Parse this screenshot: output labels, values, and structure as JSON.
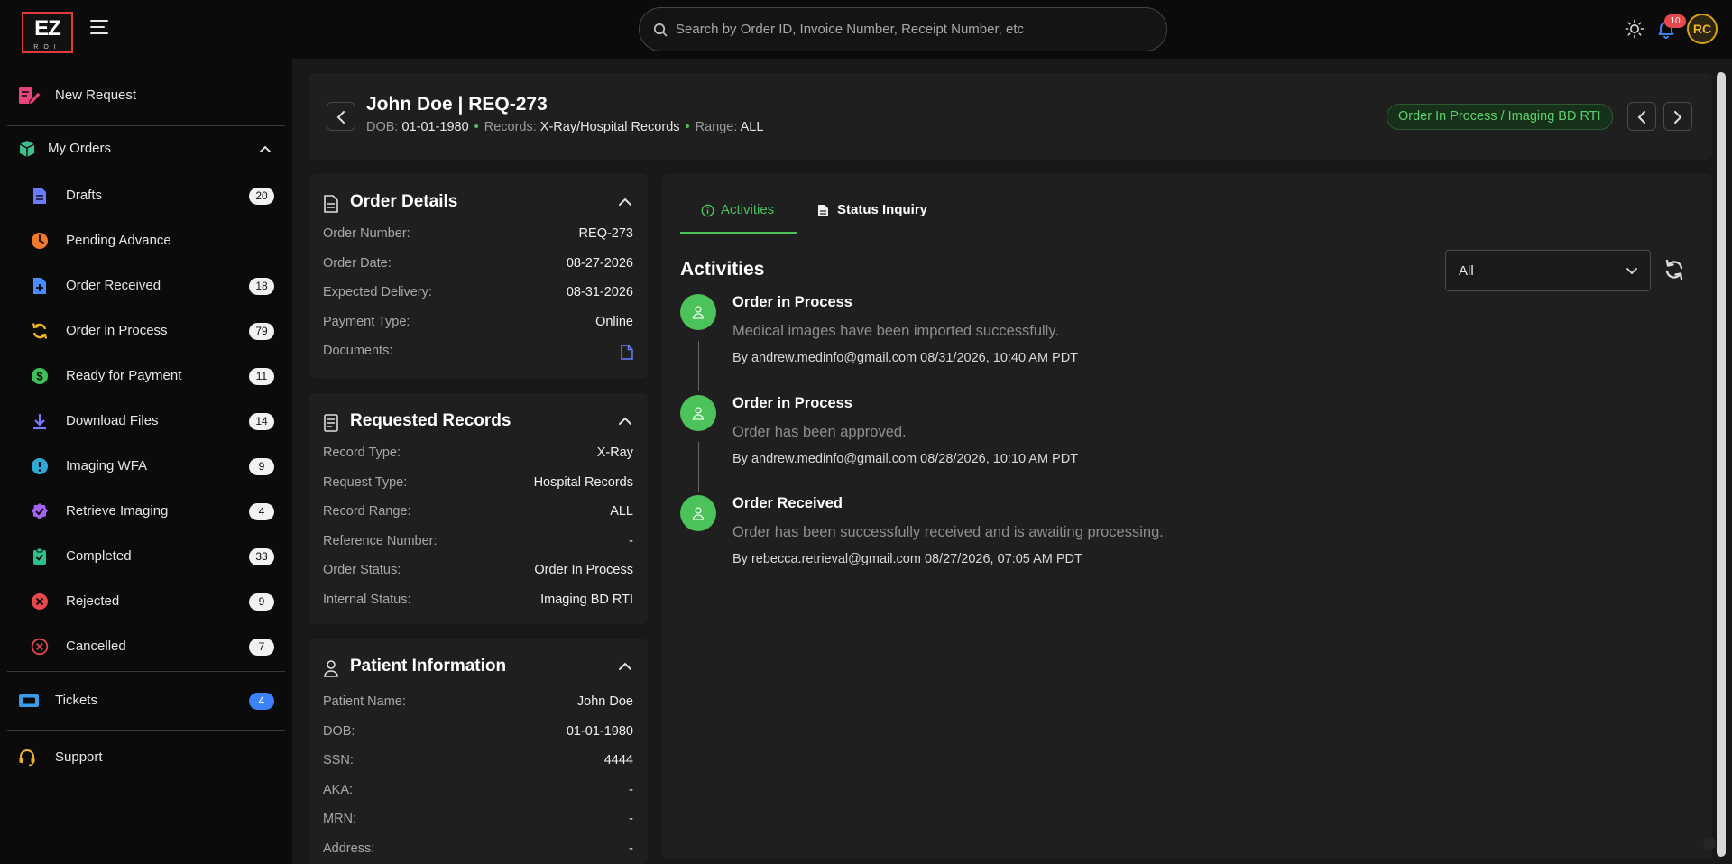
{
  "brand": {
    "logo_text": "EZ",
    "logo_sub": "ROI"
  },
  "search": {
    "placeholder": "Search by Order ID, Invoice Number, Receipt Number, etc"
  },
  "topbar": {
    "notifications_count": "10",
    "avatar_initials": "RC"
  },
  "sidebar": {
    "new_request": "New Request",
    "my_orders": "My Orders",
    "items": [
      {
        "label": "Drafts",
        "count": "20",
        "icon": "document-icon",
        "color": "#6b7bff"
      },
      {
        "label": "Pending Advance",
        "count": "",
        "icon": "clock-icon",
        "color": "#f07a2e"
      },
      {
        "label": "Order Received",
        "count": "18",
        "icon": "file-plus-icon",
        "color": "#4a8cff"
      },
      {
        "label": "Order in Process",
        "count": "79",
        "icon": "sync-icon",
        "color": "#f0b429"
      },
      {
        "label": "Ready for Payment",
        "count": "11",
        "icon": "dollar-icon",
        "color": "#3fbf5a"
      },
      {
        "label": "Download Files",
        "count": "14",
        "icon": "download-icon",
        "color": "#7a7aff"
      },
      {
        "label": "Imaging WFA",
        "count": "9",
        "icon": "alert-icon",
        "color": "#2fa8d8"
      },
      {
        "label": "Retrieve Imaging",
        "count": "4",
        "icon": "check-badge-icon",
        "color": "#a463f2"
      },
      {
        "label": "Completed",
        "count": "33",
        "icon": "clipboard-check-icon",
        "color": "#2fbf8a"
      },
      {
        "label": "Rejected",
        "count": "9",
        "icon": "x-circle-icon",
        "color": "#e5484d"
      },
      {
        "label": "Cancelled",
        "count": "7",
        "icon": "x-circle-outline-icon",
        "color": "#e5484d"
      }
    ],
    "tickets": {
      "label": "Tickets",
      "count": "4"
    },
    "support": {
      "label": "Support"
    }
  },
  "header": {
    "title": "John Doe | REQ-273",
    "dob_label": "DOB:",
    "dob": "01-01-1980",
    "records_label": "Records:",
    "records": "X-Ray/Hospital Records",
    "range_label": "Range:",
    "range": "ALL",
    "status": "Order In Process / Imaging BD RTI"
  },
  "order_details": {
    "title": "Order Details",
    "rows": [
      {
        "k": "Order Number:",
        "v": "REQ-273"
      },
      {
        "k": "Order Date:",
        "v": "08-27-2026"
      },
      {
        "k": "Expected Delivery:",
        "v": "08-31-2026"
      },
      {
        "k": "Payment Type:",
        "v": "Online"
      },
      {
        "k": "Documents:",
        "v": ""
      }
    ]
  },
  "requested_records": {
    "title": "Requested Records",
    "rows": [
      {
        "k": "Record Type:",
        "v": "X-Ray"
      },
      {
        "k": "Request Type:",
        "v": "Hospital Records"
      },
      {
        "k": "Record Range:",
        "v": "ALL"
      },
      {
        "k": "Reference Number:",
        "v": "-"
      },
      {
        "k": "Order Status:",
        "v": "Order In Process"
      },
      {
        "k": "Internal Status:",
        "v": "Imaging BD RTI"
      }
    ]
  },
  "patient_info": {
    "title": "Patient Information",
    "rows": [
      {
        "k": "Patient Name:",
        "v": "John Doe"
      },
      {
        "k": "DOB:",
        "v": "01-01-1980"
      },
      {
        "k": "SSN:",
        "v": "4444"
      },
      {
        "k": "AKA:",
        "v": "-"
      },
      {
        "k": "MRN:",
        "v": "-"
      },
      {
        "k": "Address:",
        "v": "-"
      }
    ]
  },
  "tabs": [
    {
      "label": "Activities",
      "active": true
    },
    {
      "label": "Status Inquiry",
      "active": false
    }
  ],
  "activities": {
    "heading": "Activities",
    "filter": "All",
    "items": [
      {
        "title": "Order in Process",
        "desc": "Medical images have been imported successfully.",
        "by": "By andrew.medinfo@gmail.com 08/31/2026, 10:40 AM PDT"
      },
      {
        "title": "Order in Process",
        "desc": "Order has been approved.",
        "by": "By andrew.medinfo@gmail.com 08/28/2026, 10:10 AM PDT"
      },
      {
        "title": "Order Received",
        "desc": "Order has been successfully received and is awaiting processing.",
        "by": "By rebecca.retrieval@gmail.com 08/27/2026, 07:05 AM PDT"
      }
    ]
  },
  "colors": {
    "accent": "#4cc25a",
    "danger": "#e5484d",
    "tickets": "#3b82f6"
  }
}
